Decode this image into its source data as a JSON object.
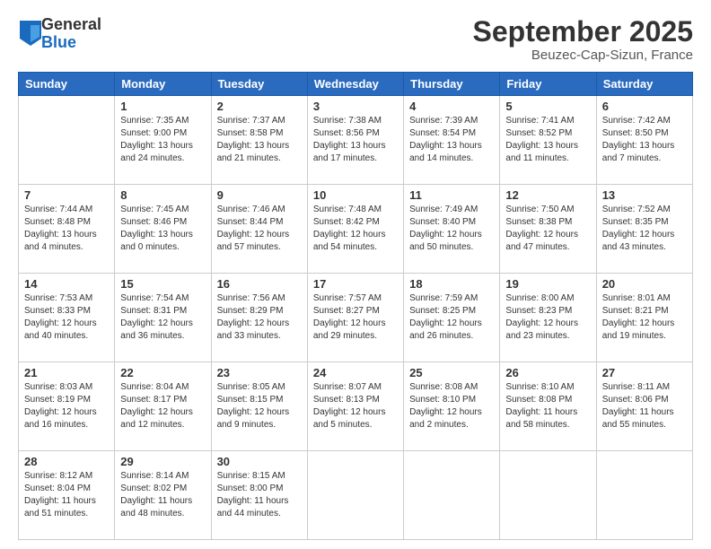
{
  "header": {
    "logo_general": "General",
    "logo_blue": "Blue",
    "month_title": "September 2025",
    "location": "Beuzec-Cap-Sizun, France"
  },
  "days_of_week": [
    "Sunday",
    "Monday",
    "Tuesday",
    "Wednesday",
    "Thursday",
    "Friday",
    "Saturday"
  ],
  "weeks": [
    [
      {
        "day": "",
        "info": ""
      },
      {
        "day": "1",
        "info": "Sunrise: 7:35 AM\nSunset: 9:00 PM\nDaylight: 13 hours\nand 24 minutes."
      },
      {
        "day": "2",
        "info": "Sunrise: 7:37 AM\nSunset: 8:58 PM\nDaylight: 13 hours\nand 21 minutes."
      },
      {
        "day": "3",
        "info": "Sunrise: 7:38 AM\nSunset: 8:56 PM\nDaylight: 13 hours\nand 17 minutes."
      },
      {
        "day": "4",
        "info": "Sunrise: 7:39 AM\nSunset: 8:54 PM\nDaylight: 13 hours\nand 14 minutes."
      },
      {
        "day": "5",
        "info": "Sunrise: 7:41 AM\nSunset: 8:52 PM\nDaylight: 13 hours\nand 11 minutes."
      },
      {
        "day": "6",
        "info": "Sunrise: 7:42 AM\nSunset: 8:50 PM\nDaylight: 13 hours\nand 7 minutes."
      }
    ],
    [
      {
        "day": "7",
        "info": "Sunrise: 7:44 AM\nSunset: 8:48 PM\nDaylight: 13 hours\nand 4 minutes."
      },
      {
        "day": "8",
        "info": "Sunrise: 7:45 AM\nSunset: 8:46 PM\nDaylight: 13 hours\nand 0 minutes."
      },
      {
        "day": "9",
        "info": "Sunrise: 7:46 AM\nSunset: 8:44 PM\nDaylight: 12 hours\nand 57 minutes."
      },
      {
        "day": "10",
        "info": "Sunrise: 7:48 AM\nSunset: 8:42 PM\nDaylight: 12 hours\nand 54 minutes."
      },
      {
        "day": "11",
        "info": "Sunrise: 7:49 AM\nSunset: 8:40 PM\nDaylight: 12 hours\nand 50 minutes."
      },
      {
        "day": "12",
        "info": "Sunrise: 7:50 AM\nSunset: 8:38 PM\nDaylight: 12 hours\nand 47 minutes."
      },
      {
        "day": "13",
        "info": "Sunrise: 7:52 AM\nSunset: 8:35 PM\nDaylight: 12 hours\nand 43 minutes."
      }
    ],
    [
      {
        "day": "14",
        "info": "Sunrise: 7:53 AM\nSunset: 8:33 PM\nDaylight: 12 hours\nand 40 minutes."
      },
      {
        "day": "15",
        "info": "Sunrise: 7:54 AM\nSunset: 8:31 PM\nDaylight: 12 hours\nand 36 minutes."
      },
      {
        "day": "16",
        "info": "Sunrise: 7:56 AM\nSunset: 8:29 PM\nDaylight: 12 hours\nand 33 minutes."
      },
      {
        "day": "17",
        "info": "Sunrise: 7:57 AM\nSunset: 8:27 PM\nDaylight: 12 hours\nand 29 minutes."
      },
      {
        "day": "18",
        "info": "Sunrise: 7:59 AM\nSunset: 8:25 PM\nDaylight: 12 hours\nand 26 minutes."
      },
      {
        "day": "19",
        "info": "Sunrise: 8:00 AM\nSunset: 8:23 PM\nDaylight: 12 hours\nand 23 minutes."
      },
      {
        "day": "20",
        "info": "Sunrise: 8:01 AM\nSunset: 8:21 PM\nDaylight: 12 hours\nand 19 minutes."
      }
    ],
    [
      {
        "day": "21",
        "info": "Sunrise: 8:03 AM\nSunset: 8:19 PM\nDaylight: 12 hours\nand 16 minutes."
      },
      {
        "day": "22",
        "info": "Sunrise: 8:04 AM\nSunset: 8:17 PM\nDaylight: 12 hours\nand 12 minutes."
      },
      {
        "day": "23",
        "info": "Sunrise: 8:05 AM\nSunset: 8:15 PM\nDaylight: 12 hours\nand 9 minutes."
      },
      {
        "day": "24",
        "info": "Sunrise: 8:07 AM\nSunset: 8:13 PM\nDaylight: 12 hours\nand 5 minutes."
      },
      {
        "day": "25",
        "info": "Sunrise: 8:08 AM\nSunset: 8:10 PM\nDaylight: 12 hours\nand 2 minutes."
      },
      {
        "day": "26",
        "info": "Sunrise: 8:10 AM\nSunset: 8:08 PM\nDaylight: 11 hours\nand 58 minutes."
      },
      {
        "day": "27",
        "info": "Sunrise: 8:11 AM\nSunset: 8:06 PM\nDaylight: 11 hours\nand 55 minutes."
      }
    ],
    [
      {
        "day": "28",
        "info": "Sunrise: 8:12 AM\nSunset: 8:04 PM\nDaylight: 11 hours\nand 51 minutes."
      },
      {
        "day": "29",
        "info": "Sunrise: 8:14 AM\nSunset: 8:02 PM\nDaylight: 11 hours\nand 48 minutes."
      },
      {
        "day": "30",
        "info": "Sunrise: 8:15 AM\nSunset: 8:00 PM\nDaylight: 11 hours\nand 44 minutes."
      },
      {
        "day": "",
        "info": ""
      },
      {
        "day": "",
        "info": ""
      },
      {
        "day": "",
        "info": ""
      },
      {
        "day": "",
        "info": ""
      }
    ]
  ]
}
